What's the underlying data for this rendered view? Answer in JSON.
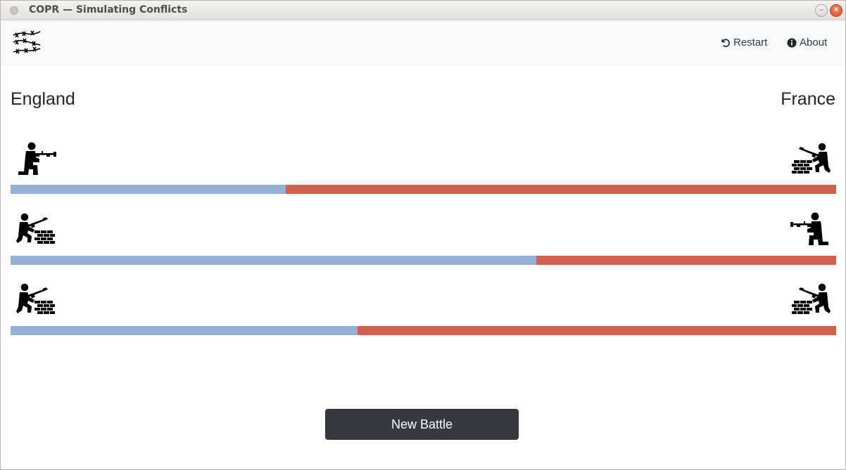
{
  "window": {
    "title": "COPR — Simulating Conflicts"
  },
  "navbar": {
    "logo_icon": "barbed-wire-icon",
    "restart_label": "Restart",
    "restart_icon": "undo-icon",
    "about_label": "About",
    "about_icon": "info-circle-icon"
  },
  "teams": {
    "left": "England",
    "right": "France"
  },
  "rows": [
    {
      "left_unit": "kneeling-rifleman-icon",
      "right_unit": "rifleman-behind-wall-icon",
      "left_share": 0.333
    },
    {
      "left_unit": "rifleman-behind-wall-icon",
      "right_unit": "kneeling-rifleman-icon",
      "left_share": 0.637
    },
    {
      "left_unit": "rifleman-behind-wall-icon",
      "right_unit": "rifleman-behind-wall-icon",
      "left_share": 0.42
    }
  ],
  "colors": {
    "left": "#93b1d6",
    "right": "#d1604f",
    "button": "#343a40"
  },
  "button": {
    "new_battle_label": "New Battle"
  }
}
